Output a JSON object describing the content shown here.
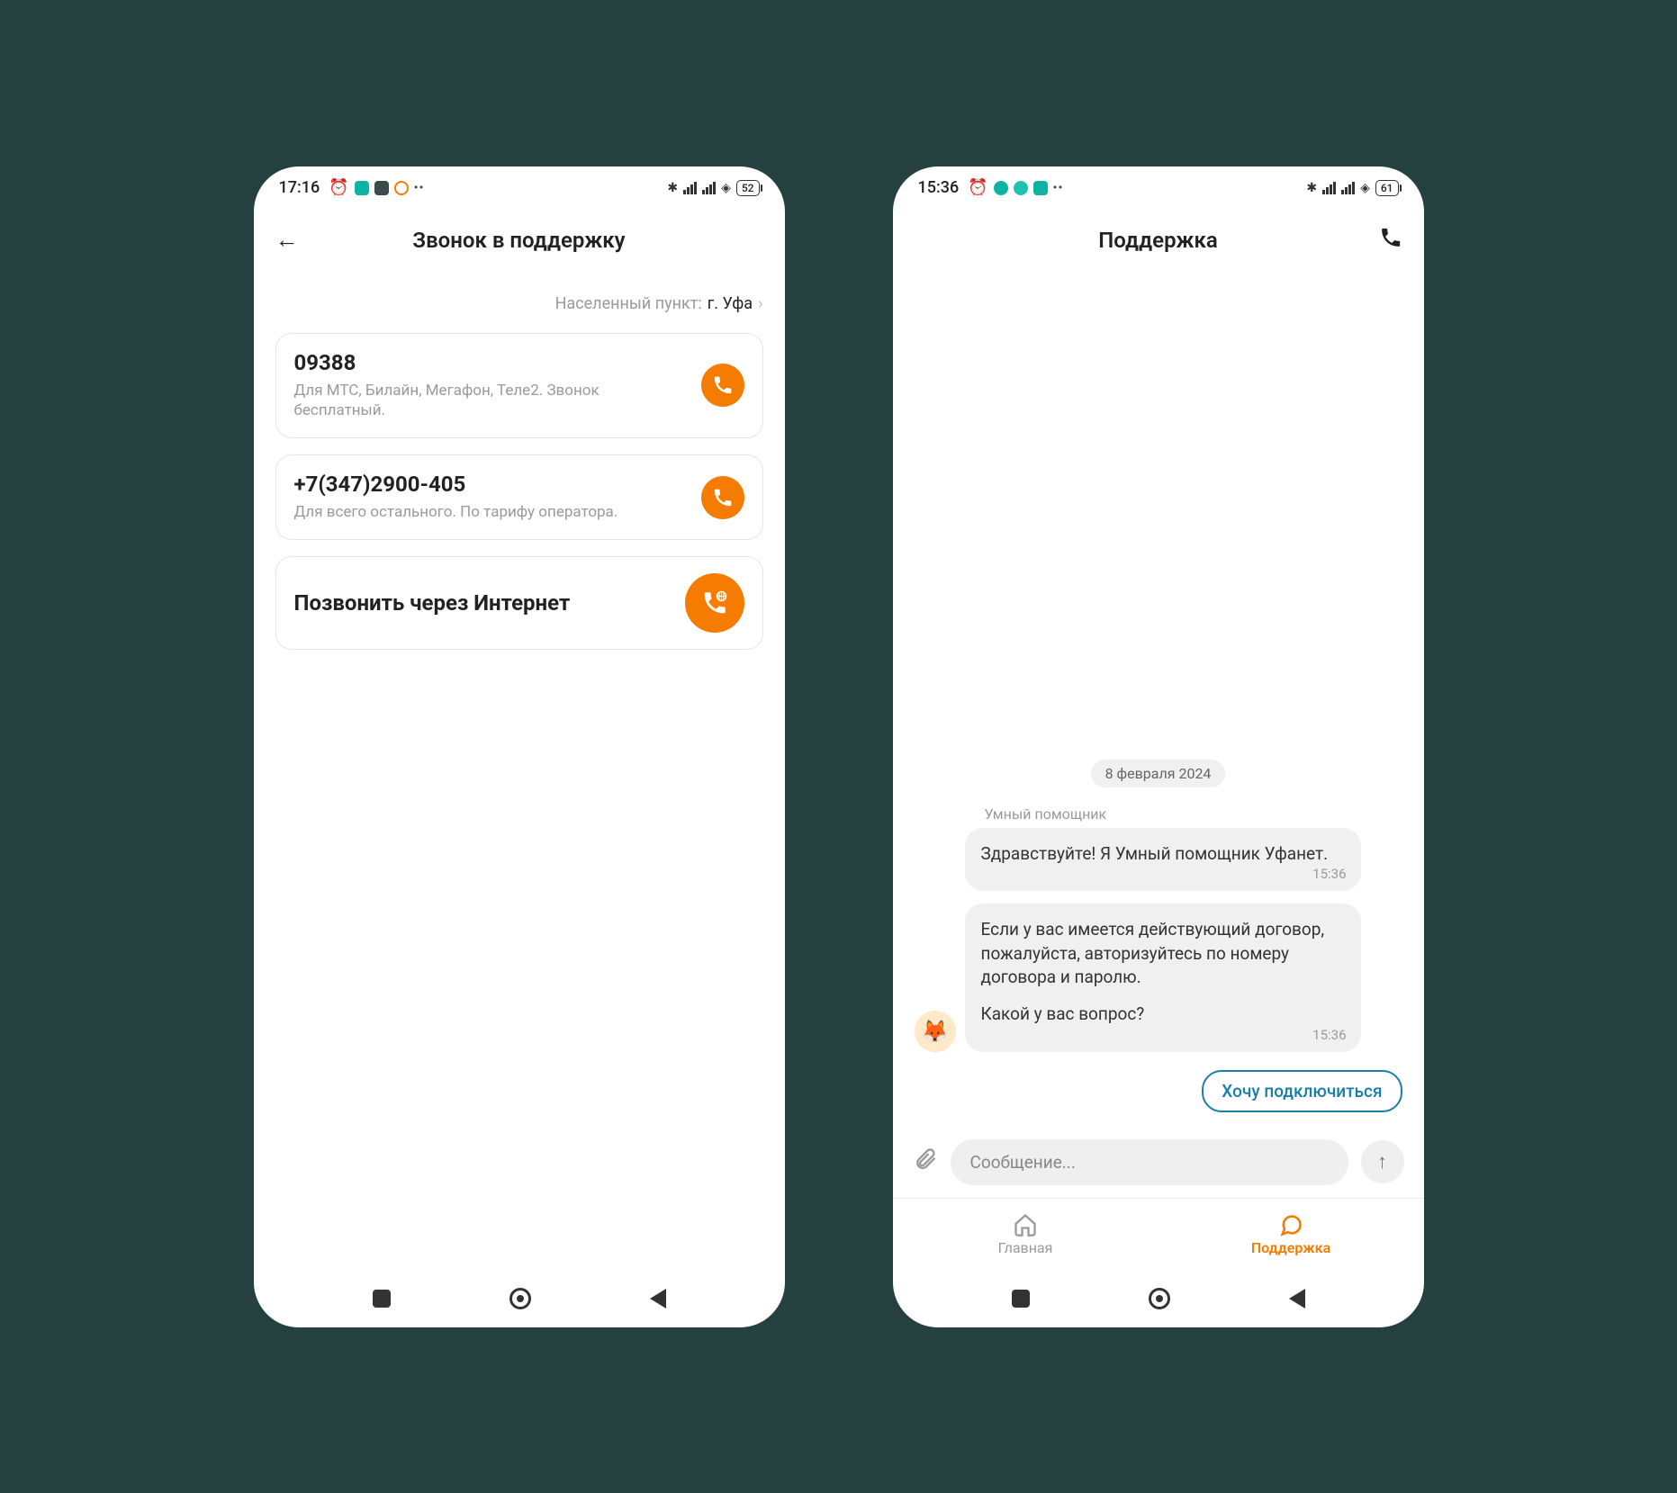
{
  "left": {
    "status": {
      "time": "17:16",
      "battery": "52"
    },
    "header": {
      "title": "Звонок в поддержку"
    },
    "locality": {
      "label": "Населенный пункт:",
      "value": "г. Уфа"
    },
    "cards": [
      {
        "number": "09388",
        "desc": "Для МТС, Билайн, Мегафон, Теле2. Звонок бесплатный."
      },
      {
        "number": "+7(347)2900-405",
        "desc": "Для всего остального. По тарифу оператора."
      }
    ],
    "voip": {
      "title": "Позвонить через Интернет"
    }
  },
  "right": {
    "status": {
      "time": "15:36",
      "battery": "61"
    },
    "header": {
      "title": "Поддержка"
    },
    "chat": {
      "date": "8 февраля 2024",
      "sender": "Умный помощник",
      "messages": [
        {
          "text": "Здравствуйте! Я Умный помощник Уфанет.",
          "time": "15:36"
        },
        {
          "text1": "Если у вас имеется действующий договор, пожалуйста, авторизуйтесь по номеру договора и паролю.",
          "text2": "Какой у вас вопрос?",
          "time": "15:36"
        }
      ],
      "chip": "Хочу подключиться",
      "input_placeholder": "Сообщение..."
    },
    "nav": {
      "home": "Главная",
      "support": "Поддержка"
    }
  }
}
